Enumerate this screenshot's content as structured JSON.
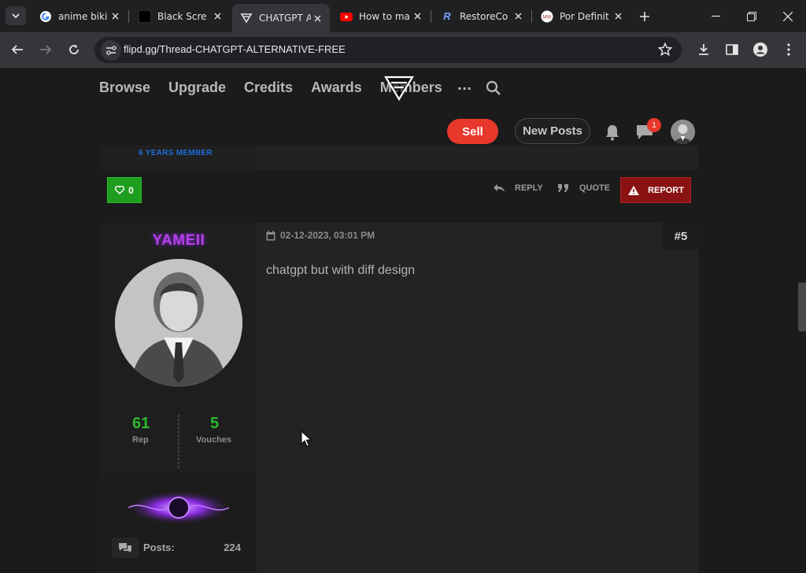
{
  "browser": {
    "tabs": [
      {
        "title": "anime biki",
        "favicon": "google-icon",
        "active": false
      },
      {
        "title": "Black Scre",
        "favicon": "black-square-icon",
        "active": false
      },
      {
        "title": "CHATGPT A",
        "favicon": "flipd-logo-icon",
        "active": true
      },
      {
        "title": "How to ma",
        "favicon": "youtube-icon",
        "active": false
      },
      {
        "title": "RestoreCo",
        "favicon": "restore-r-icon",
        "active": false
      },
      {
        "title": "Por Definit",
        "favicon": "mw-icon",
        "active": false
      }
    ],
    "url": "flipd.gg/Thread-CHATGPT-ALTERNATIVE-FREE"
  },
  "site_nav": {
    "links": [
      "Browse",
      "Upgrade",
      "Credits",
      "Awards",
      "Members"
    ],
    "more": "···"
  },
  "header_actions": {
    "sell": "Sell",
    "new_posts": "New Posts",
    "notification_count": "1"
  },
  "previous_post": {
    "member_badge": "6 YEARS MEMBER",
    "like_count": "0",
    "reply": "REPLY",
    "quote": "QUOTE",
    "report": "REPORT"
  },
  "post": {
    "username": "YAMEII",
    "date": "02-12-2023, 03:01 PM",
    "number": "#5",
    "content": "chatgpt but with diff design",
    "rep_value": "61",
    "rep_label": "Rep",
    "vouches_value": "5",
    "vouches_label": "Vouches",
    "posts_label": "Posts:",
    "posts_value": "224"
  },
  "colors": {
    "accent_red": "#e8372b",
    "username_purple": "#b640e6",
    "stat_green": "#2eb82e",
    "like_green": "#1f9d1f",
    "report_red": "#8a1212"
  }
}
